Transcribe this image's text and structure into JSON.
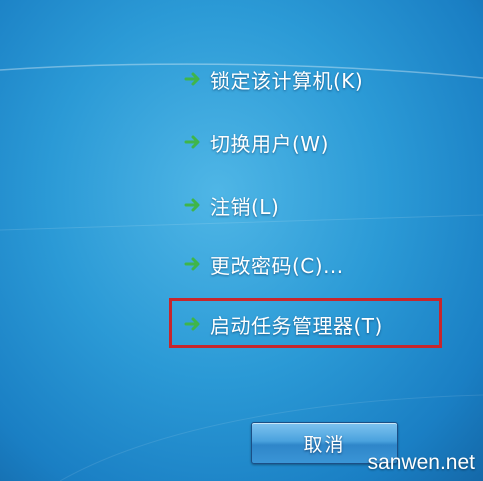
{
  "menu": {
    "items": [
      {
        "label": "锁定该计算机(K)",
        "icon": "arrow-right-icon"
      },
      {
        "label": "切换用户(W)",
        "icon": "arrow-right-icon"
      },
      {
        "label": "注销(L)",
        "icon": "arrow-right-icon"
      },
      {
        "label": "更改密码(C)...",
        "icon": "arrow-right-icon"
      },
      {
        "label": "启动任务管理器(T)",
        "icon": "arrow-right-icon"
      }
    ]
  },
  "cancel_button": {
    "label": "取消"
  },
  "watermark": {
    "text": "sanwen.net"
  },
  "colors": {
    "background": "#2b9ad6",
    "arrow": "#3fb54a",
    "highlight_border": "#c7262c",
    "text": "#ffffff"
  }
}
